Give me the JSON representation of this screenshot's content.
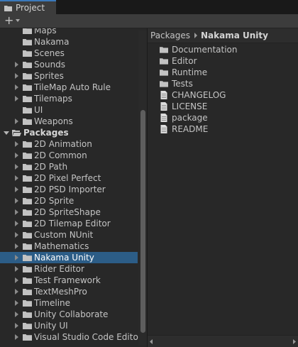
{
  "window": {
    "tab_label": "Project"
  },
  "toolbar": {
    "add_label": "+"
  },
  "tree": {
    "items": [
      {
        "label": "Maps",
        "indent": 2,
        "arrow": "none",
        "bold": false,
        "selected": false
      },
      {
        "label": "Nakama",
        "indent": 2,
        "arrow": "none",
        "bold": false,
        "selected": false
      },
      {
        "label": "Scenes",
        "indent": 2,
        "arrow": "none",
        "bold": false,
        "selected": false
      },
      {
        "label": "Sounds",
        "indent": 2,
        "arrow": "right",
        "bold": false,
        "selected": false
      },
      {
        "label": "Sprites",
        "indent": 2,
        "arrow": "right",
        "bold": false,
        "selected": false
      },
      {
        "label": "TileMap Auto Rule",
        "indent": 2,
        "arrow": "right",
        "bold": false,
        "selected": false
      },
      {
        "label": "Tilemaps",
        "indent": 2,
        "arrow": "right",
        "bold": false,
        "selected": false
      },
      {
        "label": "UI",
        "indent": 2,
        "arrow": "none",
        "bold": false,
        "selected": false
      },
      {
        "label": "Weapons",
        "indent": 2,
        "arrow": "right",
        "bold": false,
        "selected": false
      },
      {
        "label": "Packages",
        "indent": 1,
        "arrow": "down",
        "bold": true,
        "selected": false
      },
      {
        "label": "2D Animation",
        "indent": 2,
        "arrow": "right",
        "bold": false,
        "selected": false
      },
      {
        "label": "2D Common",
        "indent": 2,
        "arrow": "right",
        "bold": false,
        "selected": false
      },
      {
        "label": "2D Path",
        "indent": 2,
        "arrow": "right",
        "bold": false,
        "selected": false
      },
      {
        "label": "2D Pixel Perfect",
        "indent": 2,
        "arrow": "right",
        "bold": false,
        "selected": false
      },
      {
        "label": "2D PSD Importer",
        "indent": 2,
        "arrow": "right",
        "bold": false,
        "selected": false
      },
      {
        "label": "2D Sprite",
        "indent": 2,
        "arrow": "right",
        "bold": false,
        "selected": false
      },
      {
        "label": "2D SpriteShape",
        "indent": 2,
        "arrow": "right",
        "bold": false,
        "selected": false
      },
      {
        "label": "2D Tilemap Editor",
        "indent": 2,
        "arrow": "right",
        "bold": false,
        "selected": false
      },
      {
        "label": "Custom NUnit",
        "indent": 2,
        "arrow": "right",
        "bold": false,
        "selected": false
      },
      {
        "label": "Mathematics",
        "indent": 2,
        "arrow": "right",
        "bold": false,
        "selected": false
      },
      {
        "label": "Nakama Unity",
        "indent": 2,
        "arrow": "right",
        "bold": false,
        "selected": true
      },
      {
        "label": "Rider Editor",
        "indent": 2,
        "arrow": "right",
        "bold": false,
        "selected": false
      },
      {
        "label": "Test Framework",
        "indent": 2,
        "arrow": "right",
        "bold": false,
        "selected": false
      },
      {
        "label": "TextMeshPro",
        "indent": 2,
        "arrow": "right",
        "bold": false,
        "selected": false
      },
      {
        "label": "Timeline",
        "indent": 2,
        "arrow": "right",
        "bold": false,
        "selected": false
      },
      {
        "label": "Unity Collaborate",
        "indent": 2,
        "arrow": "right",
        "bold": false,
        "selected": false
      },
      {
        "label": "Unity UI",
        "indent": 2,
        "arrow": "right",
        "bold": false,
        "selected": false
      },
      {
        "label": "Visual Studio Code Editor",
        "indent": 2,
        "arrow": "right",
        "bold": false,
        "selected": false
      }
    ]
  },
  "breadcrumb": {
    "parent": "Packages",
    "current": "Nakama Unity"
  },
  "contents": {
    "items": [
      {
        "name": "Documentation",
        "kind": "folder"
      },
      {
        "name": "Editor",
        "kind": "folder"
      },
      {
        "name": "Runtime",
        "kind": "folder"
      },
      {
        "name": "Tests",
        "kind": "folder"
      },
      {
        "name": "CHANGELOG",
        "kind": "file"
      },
      {
        "name": "LICENSE",
        "kind": "file"
      },
      {
        "name": "package",
        "kind": "file"
      },
      {
        "name": "README",
        "kind": "file"
      }
    ]
  },
  "colors": {
    "selection": "#2c5d87",
    "accent": "#3a79bb",
    "folder": "#c2c2c2",
    "background": "#282828"
  }
}
